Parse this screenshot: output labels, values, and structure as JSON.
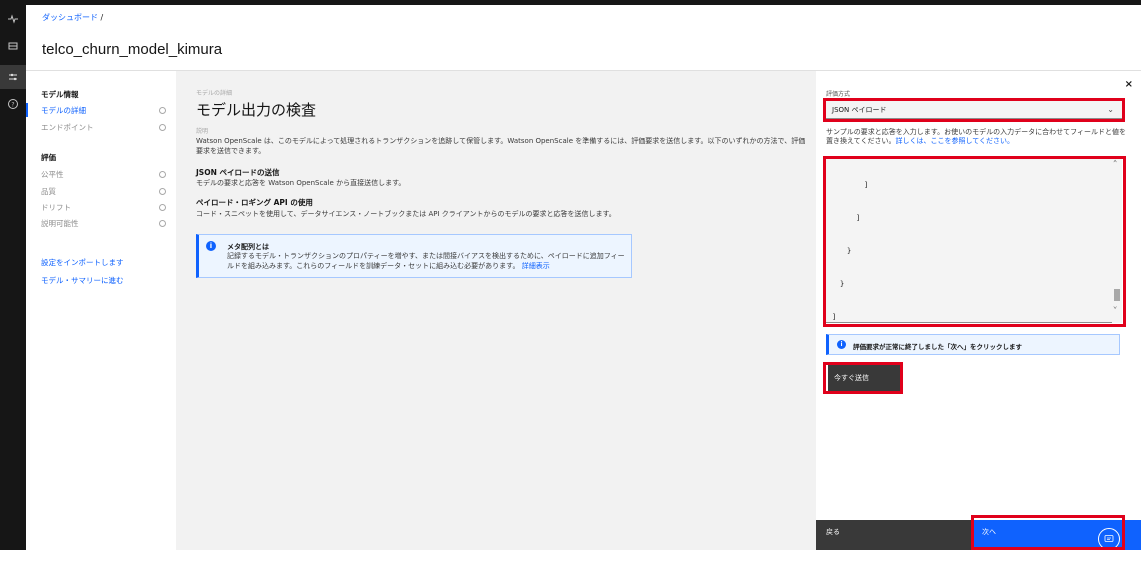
{
  "breadcrumb": {
    "link": "ダッシュボード",
    "sep": "/"
  },
  "page_title": "telco_churn_model_kimura",
  "rail": [
    "activity-icon",
    "dashboard-icon",
    "settings-adjust-icon",
    "help-icon"
  ],
  "leftnav": {
    "section_model": "モデル情報",
    "items_model": [
      {
        "label": "モデルの詳細"
      },
      {
        "label": "エンドポイント"
      }
    ],
    "section_eval": "評価",
    "items_eval": [
      {
        "label": "公平性"
      },
      {
        "label": "品質"
      },
      {
        "label": "ドリフト"
      },
      {
        "label": "説明可能性"
      }
    ],
    "link_import": "設定をインポートします",
    "link_summary": "モデル・サマリーに進む"
  },
  "main": {
    "eyebrow": "モデルの詳細",
    "title": "モデル出力の検査",
    "desc_label": "説明",
    "desc": "Watson OpenScale は、このモデルによって処理されるトランザクションを追跡して保管します。Watson OpenScale を準備するには、評価要求を送信します。以下のいずれかの方法で、評価要求を送信できます。",
    "json_title": "JSON ペイロードの送信",
    "json_text": "モデルの要求と応答を Watson OpenScale から直接送信します。",
    "api_title": "ペイロード・ロギング API の使用",
    "api_text": "コード・スニペットを使用して、データサイエンス・ノートブックまたは API クライアントからのモデルの要求と応答を送信します。",
    "notice_title": "メタ配列とは",
    "notice_text": "記録するモデル・トランザクションのプロパティーを増やす、または間接バイアスを検出するために、ペイロードに追加フィールドを組み込みます。これらのフィールドを訓練データ・セットに組み込む必要があります。",
    "notice_link": "詳細表示"
  },
  "panel": {
    "close": "×",
    "method_label": "評価方式",
    "method_value": "JSON ペイロード",
    "help_text": "サンプルの要求と応答を入力します。お使いのモデルの入力データに合わせてフィールドと値を置き換えてください。",
    "help_link": "詳しくは、ここを参照してください。",
    "code_lines": [
      "]",
      "]",
      "}",
      "}",
      "]"
    ],
    "success_text": "評価要求が正常に終了しました「次へ」をクリックします",
    "send_label": "今すぐ送信",
    "back_label": "戻る",
    "next_label": "次へ"
  },
  "colors": {
    "accent": "#0f62fe",
    "highlight": "#e0001b",
    "dark": "#161616"
  }
}
